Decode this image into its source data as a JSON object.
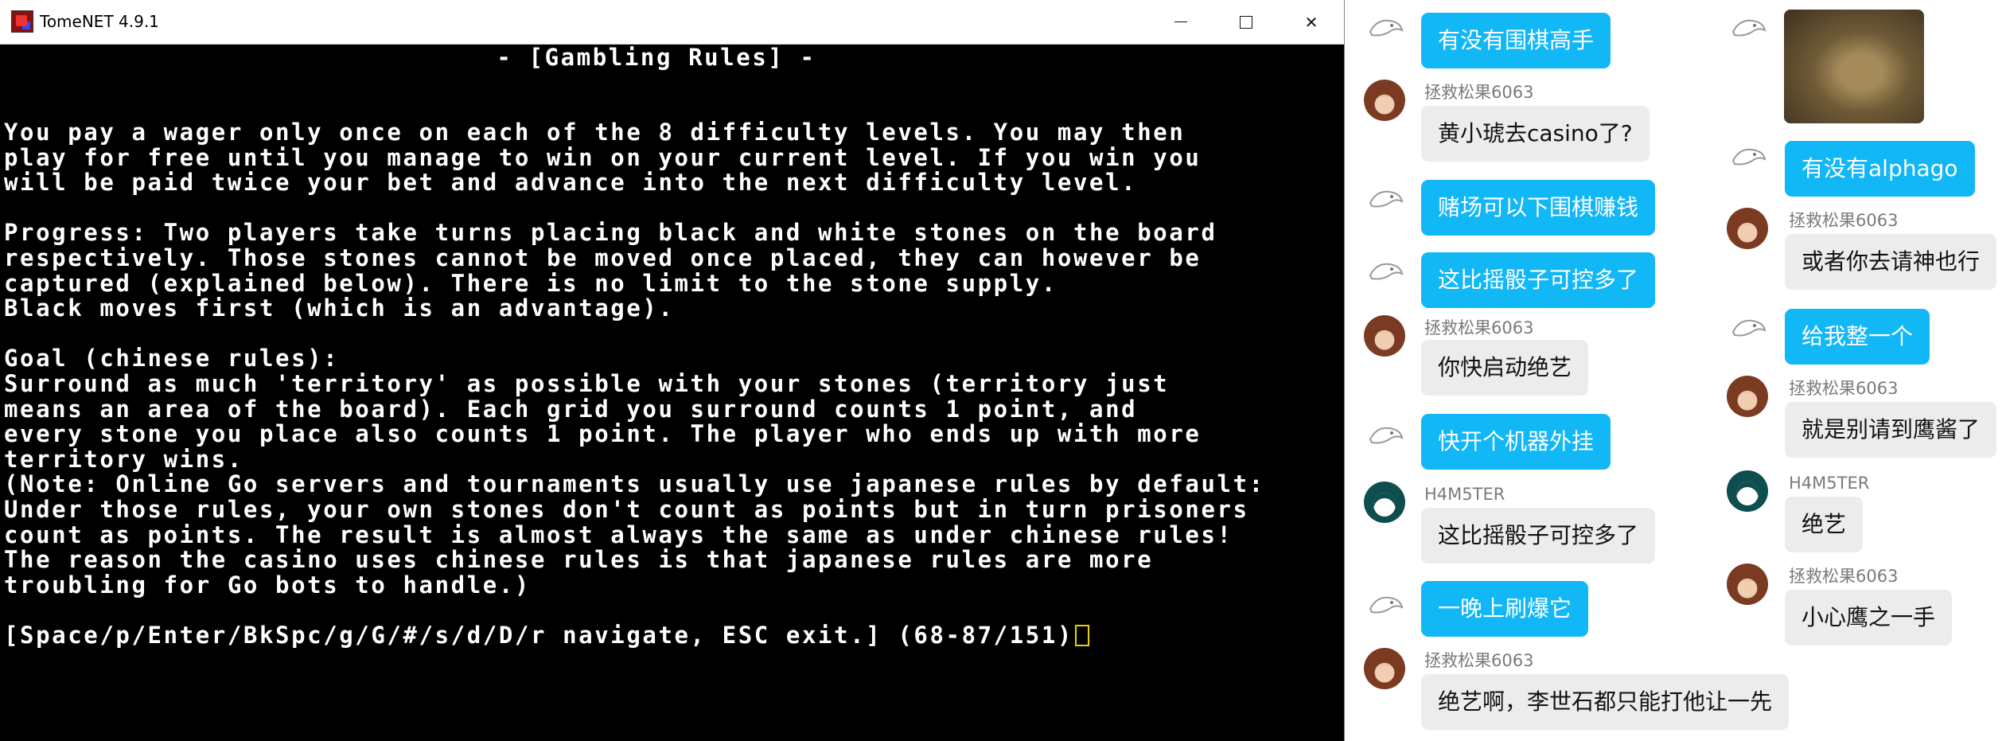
{
  "window": {
    "title": "TomeNET 4.9.1",
    "minimize_icon": "minimize-icon",
    "maximize_icon": "maximize-icon",
    "close_icon": "close-icon",
    "close_glyph": "✕"
  },
  "terminal": {
    "heading": "- [Gambling Rules] -",
    "lines": [
      "You pay a wager only once on each of the 8 difficulty levels. You may then",
      "play for free until you manage to win on your current level. If you win you",
      "will be paid twice your bet and advance into the next difficulty level.",
      "",
      "Progress: Two players take turns placing black and white stones on the board",
      "respectively. Those stones cannot be moved once placed, they can however be",
      "captured (explained below). There is no limit to the stone supply.",
      "Black moves first (which is an advantage).",
      "",
      "Goal (chinese rules):",
      "Surround as much 'territory' as possible with your stones (territory just",
      "means an area of the board). Each grid you surround counts 1 point, and",
      "every stone you place also counts 1 point. The player who ends up with more",
      "territory wins.",
      "(Note: Online Go servers and tournaments usually use japanese rules by default:",
      "Under those rules, your own stones don't count as points but in turn prisoners",
      "count as points. The result is almost always the same as under chinese rules!",
      "The reason the casino uses chinese rules is that japanese rules are more",
      "troubling for Go bots to handle.)",
      "",
      "[Space/p/Enter/BkSpc/g/G/#/s/d/D/r navigate, ESC exit.] (68-87/151)"
    ]
  },
  "chat": {
    "left_column": [
      {
        "sender": "",
        "avatar": "sketch-avatar",
        "text": "有没有围棋高手",
        "style": "blue"
      },
      {
        "sender": "拯救松果6063",
        "avatar": "girl-avatar",
        "text": "黄小琥去casino了?",
        "style": "gray"
      },
      {
        "sender": "",
        "avatar": "sketch-avatar",
        "text": "赌场可以下围棋赚钱",
        "style": "blue"
      },
      {
        "sender": "",
        "avatar": "sketch-avatar",
        "text": "这比摇骰子可控多了",
        "style": "blue"
      },
      {
        "sender": "拯救松果6063",
        "avatar": "girl-avatar",
        "text": "你快启动绝艺",
        "style": "gray"
      },
      {
        "sender": "",
        "avatar": "sketch-avatar",
        "text": "快开个机器外挂",
        "style": "blue"
      },
      {
        "sender": "H4M5TER",
        "avatar": "dark-avatar",
        "text": "这比摇骰子可控多了",
        "style": "gray"
      },
      {
        "sender": "",
        "avatar": "sketch-avatar",
        "text": "一晚上刷爆它",
        "style": "blue"
      },
      {
        "sender": "拯救松果6063",
        "avatar": "girl-avatar",
        "text": "绝艺啊，李世石都只能打他让一先",
        "style": "gray"
      }
    ],
    "right_column": [
      {
        "sender": "",
        "avatar": "sketch-avatar",
        "text": "",
        "style": "photo",
        "photo": "hedgehog-photo"
      },
      {
        "sender": "",
        "avatar": "sketch-avatar",
        "text": "有没有alphago",
        "style": "blue"
      },
      {
        "sender": "拯救松果6063",
        "avatar": "girl-avatar",
        "text": "或者你去请神也行",
        "style": "gray"
      },
      {
        "sender": "",
        "avatar": "sketch-avatar",
        "text": "给我整一个",
        "style": "blue"
      },
      {
        "sender": "拯救松果6063",
        "avatar": "girl-avatar",
        "text": "就是别请到鹰酱了",
        "style": "gray"
      },
      {
        "sender": "H4M5TER",
        "avatar": "dark-avatar",
        "text": "绝艺",
        "style": "gray"
      },
      {
        "sender": "拯救松果6063",
        "avatar": "girl-avatar",
        "text": "小心鹰之一手",
        "style": "gray"
      }
    ]
  },
  "colors": {
    "bubble_blue": "#12b7f5",
    "bubble_gray": "#ececec",
    "terminal_bg": "#000000",
    "terminal_text": "#ffffff",
    "cursor": "#e8d300"
  }
}
